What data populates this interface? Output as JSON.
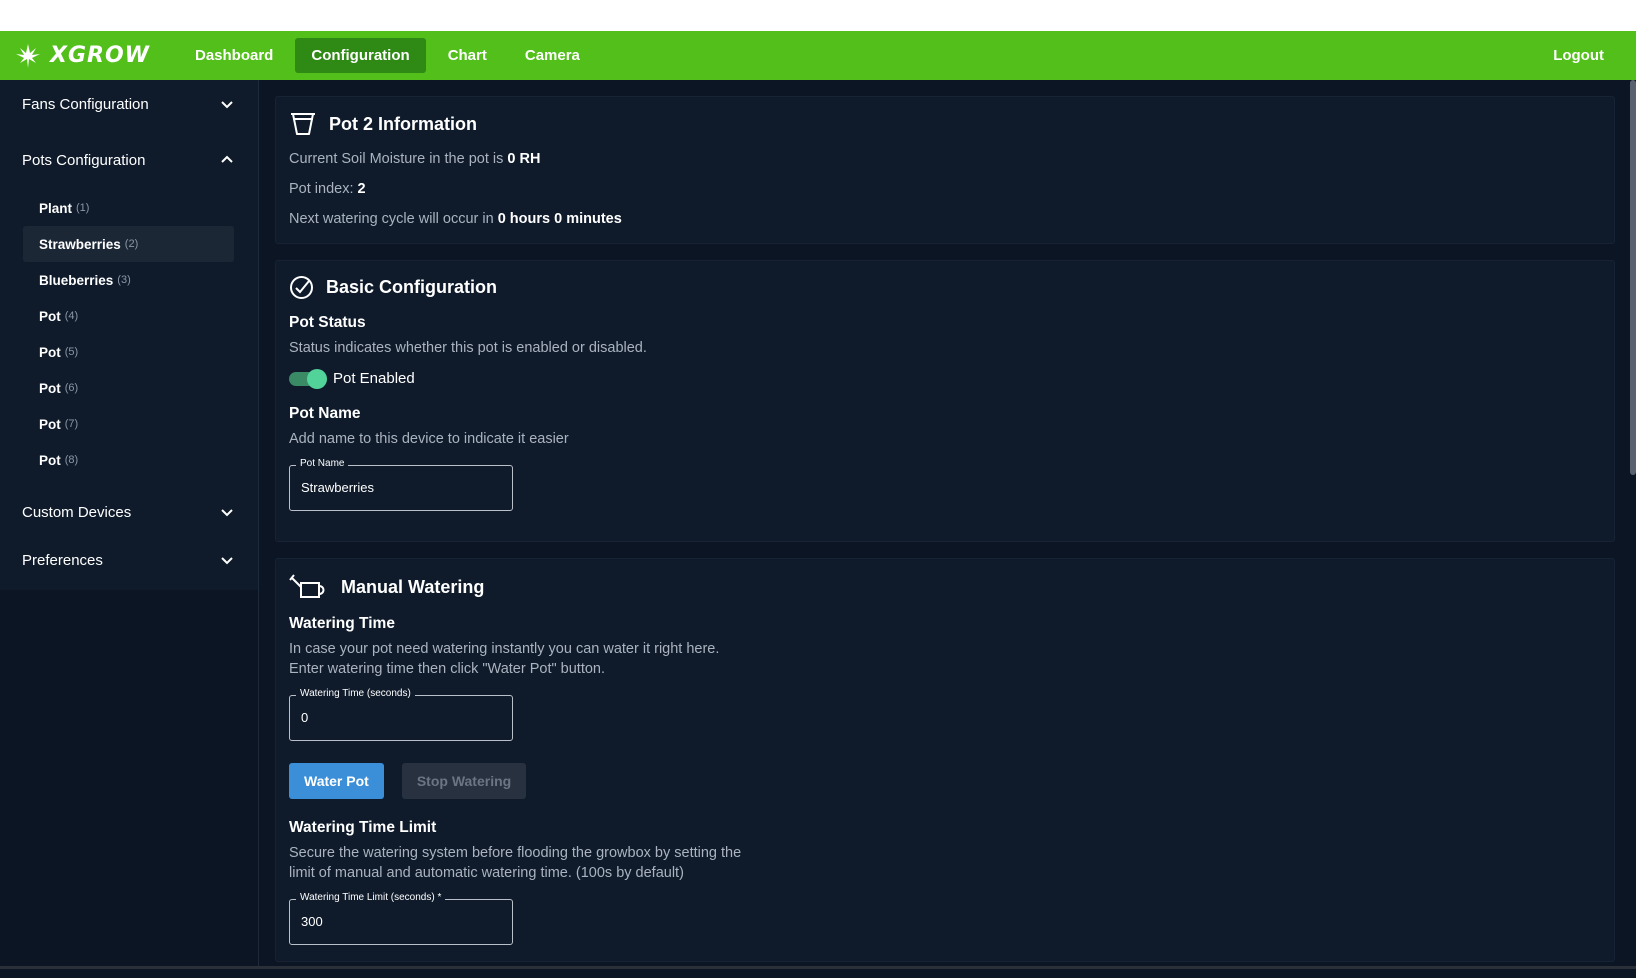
{
  "app": {
    "brand": "XGROW"
  },
  "nav": {
    "links": [
      "Dashboard",
      "Configuration",
      "Chart",
      "Camera"
    ],
    "logout": "Logout"
  },
  "sidebar": {
    "sections": {
      "fans": "Fans Configuration",
      "pots": "Pots Configuration",
      "custom": "Custom Devices",
      "preferences": "Preferences"
    },
    "pots": [
      {
        "label": "Plant",
        "count": "(1)"
      },
      {
        "label": "Strawberries",
        "count": "(2)"
      },
      {
        "label": "Blueberries",
        "count": "(3)"
      },
      {
        "label": "Pot",
        "count": "(4)"
      },
      {
        "label": "Pot",
        "count": "(5)"
      },
      {
        "label": "Pot",
        "count": "(6)"
      },
      {
        "label": "Pot",
        "count": "(7)"
      },
      {
        "label": "Pot",
        "count": "(8)"
      }
    ]
  },
  "info": {
    "title": "Pot 2 Information",
    "moisture_prefix": "Current Soil Moisture in the pot is",
    "moisture_value": "0 RH",
    "index_prefix": "Pot index:",
    "index_value": "2",
    "next_prefix": "Next watering cycle will occur in",
    "next_value": "0 hours 0 minutes"
  },
  "basic": {
    "title": "Basic Configuration",
    "status_title": "Pot Status",
    "status_desc": "Status indicates whether this pot is enabled or disabled.",
    "toggle_label": "Pot Enabled",
    "name_title": "Pot Name",
    "name_desc": "Add name to this device to indicate it easier",
    "name_legend": "Pot Name",
    "name_value": "Strawberries"
  },
  "manual": {
    "title": "Manual Watering",
    "time_title": "Watering Time",
    "time_desc1": "In case your pot need watering instantly you can water it right here.",
    "time_desc2": "Enter watering time then click \"Water Pot\" button.",
    "time_legend": "Watering Time (seconds)",
    "time_value": "0",
    "water_button": "Water Pot",
    "stop_button": "Stop Watering",
    "limit_title": "Watering Time Limit",
    "limit_desc1": "Secure the watering system before flooding the growbox by setting the",
    "limit_desc2": "limit of manual and automatic watering time. (100s by default)",
    "limit_legend": "Watering Time Limit (seconds) *",
    "limit_value": "300"
  },
  "colors": {
    "navbar": "#52bf1a",
    "nav_active": "#2e8a14",
    "background": "#0b1524",
    "card": "#0f1b2b",
    "primary_button": "#3b8fd9",
    "toggle_on": "#52d39a"
  }
}
